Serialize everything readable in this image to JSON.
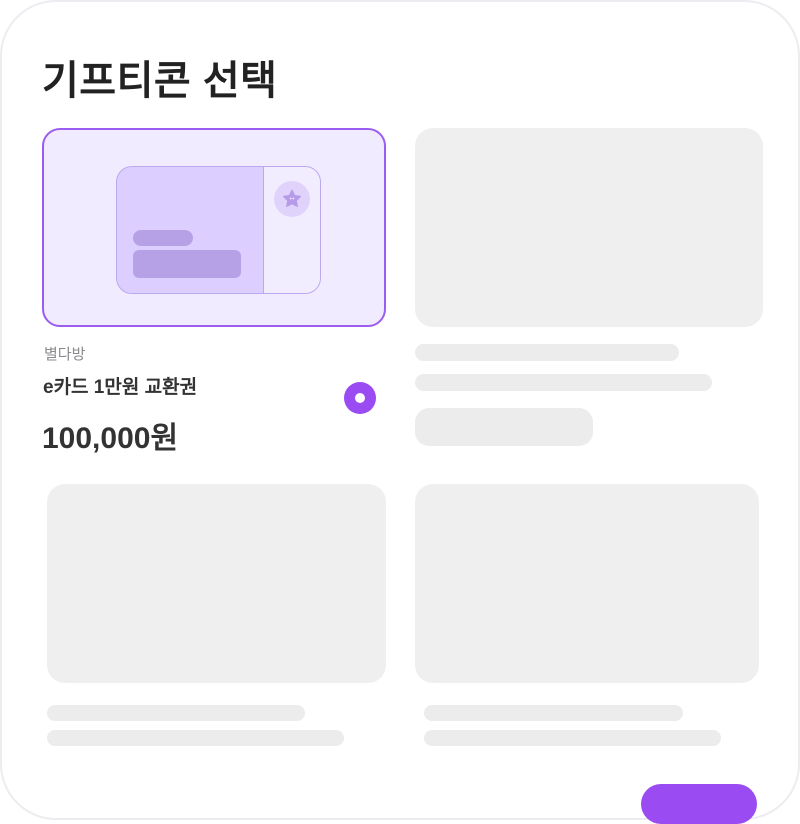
{
  "page": {
    "title": "기프티콘 선택"
  },
  "selected_item": {
    "brand": "별다방",
    "name": "e카드 1만원 교환권",
    "price": "100,000원",
    "selected": true
  },
  "colors": {
    "accent": "#9B4BF2",
    "selected_card_bg": "#F1EBFF",
    "ticket": "#DCCFFF",
    "skeleton": "#EFEFEF"
  },
  "icons": [
    "star-icon",
    "radio-selected-icon"
  ]
}
